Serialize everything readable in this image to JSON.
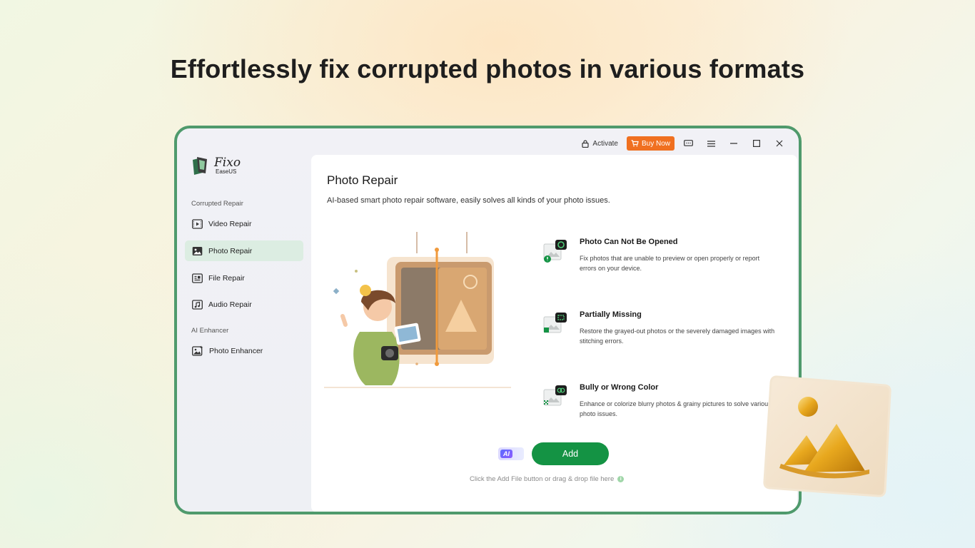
{
  "headline": "Effortlessly fix corrupted photos in various formats",
  "titlebar": {
    "activate_label": "Activate",
    "buy_now_label": "Buy Now"
  },
  "logo": {
    "main": "Fixo",
    "sub": "EaseUS"
  },
  "sidebar": {
    "section_corrupted": "Corrupted Repair",
    "items": [
      {
        "label": "Video Repair",
        "icon": "video-icon"
      },
      {
        "label": "Photo Repair",
        "icon": "photo-icon",
        "active": true
      },
      {
        "label": "File Repair",
        "icon": "file-icon"
      },
      {
        "label": "Audio Repair",
        "icon": "audio-icon"
      }
    ],
    "section_ai": "AI Enhancer",
    "ai_items": [
      {
        "label": "Photo Enhancer",
        "icon": "photo-enhancer-icon"
      }
    ]
  },
  "main": {
    "title": "Photo Repair",
    "subtitle": "AI-based smart photo repair software, easily solves all kinds of your photo issues.",
    "features": [
      {
        "title": "Photo Can Not Be Opened",
        "desc": "Fix photos that are unable to preview or open properly or report errors on your device."
      },
      {
        "title": "Partially Missing",
        "desc": "Restore the grayed-out photos or the severely damaged images with stitching errors."
      },
      {
        "title": "Bully or Wrong Color",
        "desc": "Enhance or colorize blurry photos & grainy pictures to solve various photo issues."
      }
    ],
    "ai_badge": "AI",
    "add_button": "Add",
    "hint": "Click the Add File button or drag & drop file here"
  },
  "colors": {
    "accent": "#149344",
    "buy_now": "#f07020",
    "frame": "#4f9a6c"
  }
}
